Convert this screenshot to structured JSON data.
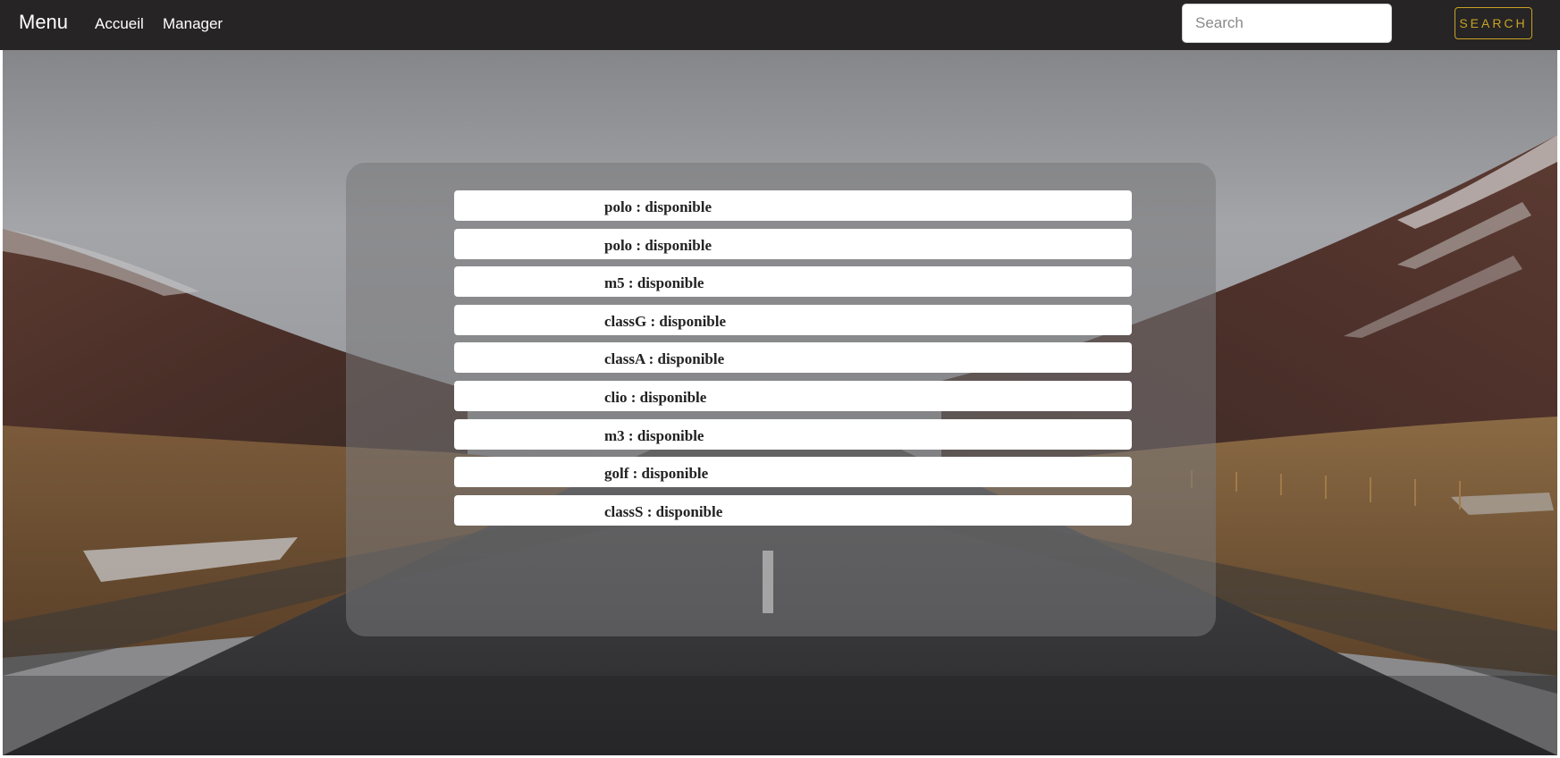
{
  "navbar": {
    "brand": "Menu",
    "links": [
      {
        "label": "Accueil"
      },
      {
        "label": "Manager"
      }
    ],
    "search": {
      "placeholder": "Search",
      "value": "",
      "button_label": "SEARCH"
    }
  },
  "cars": [
    {
      "name": "polo",
      "status": "disponible",
      "label": "polo : disponible"
    },
    {
      "name": "polo",
      "status": "disponible",
      "label": "polo : disponible"
    },
    {
      "name": "m5",
      "status": "disponible",
      "label": "m5 : disponible"
    },
    {
      "name": "classG",
      "status": "disponible",
      "label": "classG : disponible"
    },
    {
      "name": "classA",
      "status": "disponible",
      "label": "classA : disponible"
    },
    {
      "name": "clio",
      "status": "disponible",
      "label": "clio : disponible"
    },
    {
      "name": "m3",
      "status": "disponible",
      "label": "m3 : disponible"
    },
    {
      "name": "golf",
      "status": "disponible",
      "label": "golf : disponible"
    },
    {
      "name": "classS",
      "status": "disponible",
      "label": "classS : disponible"
    }
  ],
  "colors": {
    "navbar_bg": "#262424",
    "accent_gold": "#c9a227",
    "panel_overlay": "rgba(120,120,122,0.55)",
    "item_bg": "#ffffff"
  },
  "background": {
    "icon": "landscape-road-photo"
  }
}
